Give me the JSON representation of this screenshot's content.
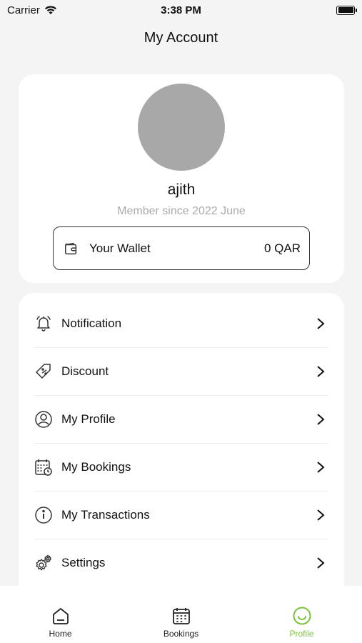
{
  "status_bar": {
    "carrier": "Carrier",
    "time": "3:38 PM"
  },
  "header": {
    "title": "My Account"
  },
  "profile": {
    "name": "ajith",
    "member_since": "Member since 2022 June",
    "wallet": {
      "label": "Your Wallet",
      "amount": "0 QAR"
    }
  },
  "menu": {
    "items": [
      {
        "label": "Notification",
        "icon": "bell-icon"
      },
      {
        "label": "Discount",
        "icon": "tag-icon"
      },
      {
        "label": "My Profile",
        "icon": "user-circle-icon"
      },
      {
        "label": "My Bookings",
        "icon": "calendar-clock-icon"
      },
      {
        "label": "My Transactions",
        "icon": "info-icon"
      },
      {
        "label": "Settings",
        "icon": "gear-icon"
      }
    ]
  },
  "tab_bar": {
    "tabs": [
      {
        "label": "Home",
        "icon": "home-icon",
        "active": false
      },
      {
        "label": "Bookings",
        "icon": "calendar-icon",
        "active": false
      },
      {
        "label": "Profile",
        "icon": "profile-icon",
        "active": true
      }
    ]
  },
  "colors": {
    "accent": "#7cc33d",
    "background": "#f4f4f4",
    "card": "#ffffff",
    "avatar_placeholder": "#a8a8a8"
  }
}
